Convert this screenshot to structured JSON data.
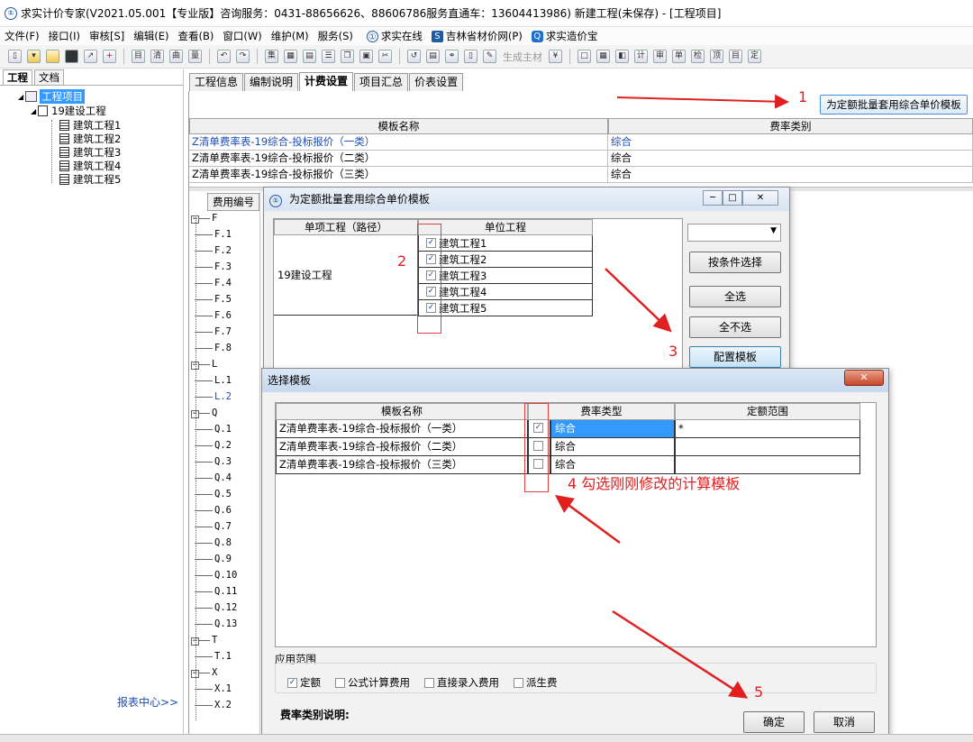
{
  "titlebar": {
    "text": "求实计价专家(V2021.05.001【专业版】咨询服务：0431-88656626、88606786服务直通车：13604413986) 新建工程(未保存) - [工程项目]"
  },
  "menu": {
    "items": [
      "文件(F)",
      "接口(I)",
      "审核[S]",
      "编辑(E)",
      "查看(B)",
      "窗口(W)",
      "维护(M)",
      "服务(S)"
    ],
    "links": [
      "求实在线",
      "吉林省材价网(P)",
      "求实造价宝"
    ]
  },
  "toolbar": {
    "material_label": "生成主材"
  },
  "left_panel": {
    "tabs": [
      "工程",
      "文档"
    ],
    "root": "工程项目",
    "project": "19建设工程",
    "units": [
      "建筑工程1",
      "建筑工程2",
      "建筑工程3",
      "建筑工程4",
      "建筑工程5"
    ],
    "report_center": "报表中心>>"
  },
  "main_tabs": [
    "工程信息",
    "编制说明",
    "计费设置",
    "项目汇总",
    "价表设置"
  ],
  "batch_button": "为定额批量套用综合单价模板",
  "template_grid": {
    "headers": [
      "模板名称",
      "费率类别"
    ],
    "rows": [
      {
        "name": "Z清单费率表-19综合-投标报价（一类）",
        "type": "综合"
      },
      {
        "name": "Z清单费率表-19综合-投标报价（二类）",
        "type": "综合"
      },
      {
        "name": "Z清单费率表-19综合-投标报价（三类）",
        "type": "综合"
      }
    ]
  },
  "fee_tree": {
    "header": "费用编号",
    "items": [
      "F",
      "F.1",
      "F.2",
      "F.3",
      "F.4",
      "F.5",
      "F.6",
      "F.7",
      "F.8",
      "L",
      "L.1",
      "L.2",
      "Q",
      "Q.1",
      "Q.2",
      "Q.3",
      "Q.4",
      "Q.5",
      "Q.6",
      "Q.7",
      "Q.8",
      "Q.9",
      "Q.10",
      "Q.11",
      "Q.12",
      "Q.13",
      "T",
      "T.1",
      "X",
      "X.1",
      "X.2"
    ]
  },
  "batch_dialog": {
    "title": "为定额批量套用综合单价模板",
    "headers": [
      "单项工程（路径）",
      "单位工程"
    ],
    "project": "19建设工程",
    "units": [
      "建筑工程1",
      "建筑工程2",
      "建筑工程3",
      "建筑工程4",
      "建筑工程5"
    ],
    "buttons": {
      "filter": "按条件选择",
      "select_all": "全选",
      "select_none": "全不选",
      "config": "配置模板"
    }
  },
  "select_dialog": {
    "title": "选择模板",
    "headers": [
      "模板名称",
      "费率类型",
      "定额范围"
    ],
    "rows": [
      {
        "name": "Z清单费率表-19综合-投标报价（一类）",
        "type": "综合",
        "range": "*",
        "checked": true
      },
      {
        "name": "Z清单费率表-19综合-投标报价（二类）",
        "type": "综合",
        "range": "",
        "checked": false
      },
      {
        "name": "Z清单费率表-19综合-投标报价（三类）",
        "type": "综合",
        "range": "",
        "checked": false
      }
    ],
    "scope_label": "应用范围",
    "scope_options": [
      {
        "label": "定额",
        "checked": true
      },
      {
        "label": "公式计算费用",
        "checked": false
      },
      {
        "label": "直接录入费用",
        "checked": false
      },
      {
        "label": "派生费",
        "checked": false
      }
    ],
    "desc_label": "费率类别说明:",
    "ok": "确定",
    "cancel": "取消"
  },
  "annotations": {
    "n1": "1",
    "n2": "2",
    "n3": "3",
    "n4": "4  勾选刚刚修改的计算模板",
    "n5": "5"
  },
  "colors": {
    "annotation": "#e02020",
    "link_blue": "#1c4cb6",
    "highlight": "#3399ff"
  }
}
